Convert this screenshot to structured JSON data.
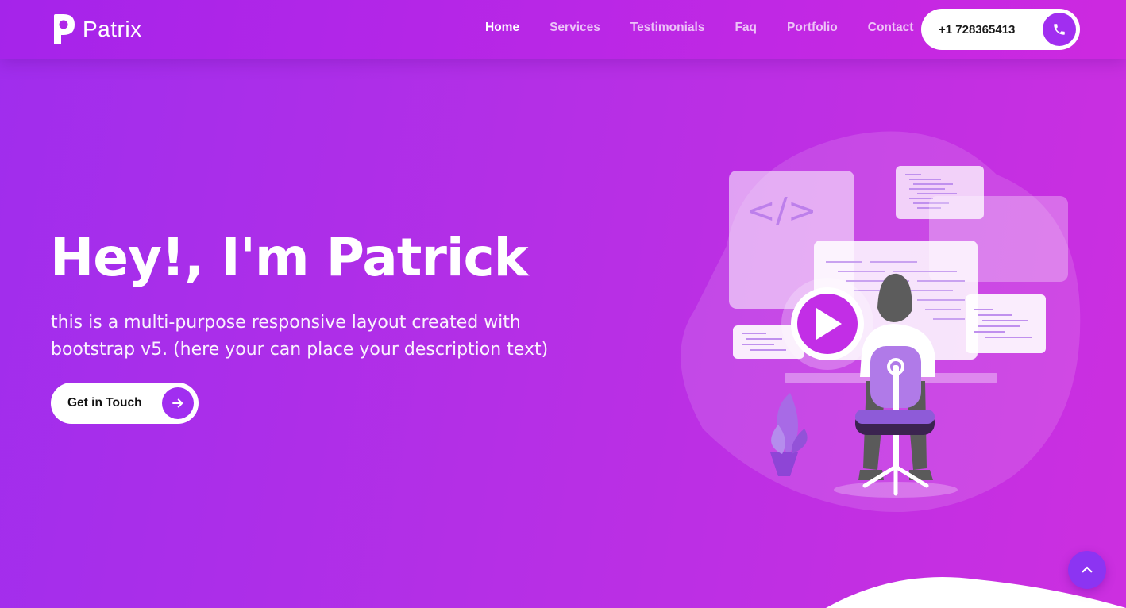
{
  "brand": {
    "name": "Patrix"
  },
  "nav": {
    "items": [
      {
        "label": "Home",
        "active": true
      },
      {
        "label": "Services",
        "active": false
      },
      {
        "label": "Testimonials",
        "active": false
      },
      {
        "label": "Faq",
        "active": false
      },
      {
        "label": "Portfolio",
        "active": false
      },
      {
        "label": "Contact",
        "active": false
      }
    ]
  },
  "phone": {
    "number": "+1 728365413",
    "icon": "phone-icon"
  },
  "hero": {
    "title": "Hey!, I'm Patrick",
    "description": "this is a multi-purpose responsive layout created with bootstrap v5. (here your can place your description text)",
    "cta_label": "Get in Touch",
    "cta_icon": "arrow-right-icon",
    "illustration_code_label": "</>"
  },
  "scroll_top": {
    "icon": "chevron-up-icon"
  },
  "colors": {
    "accent": "#a12ef0",
    "gradient_start": "#a02ded",
    "gradient_end": "#cc2fe0",
    "scroll_button": "#8c34f2"
  }
}
